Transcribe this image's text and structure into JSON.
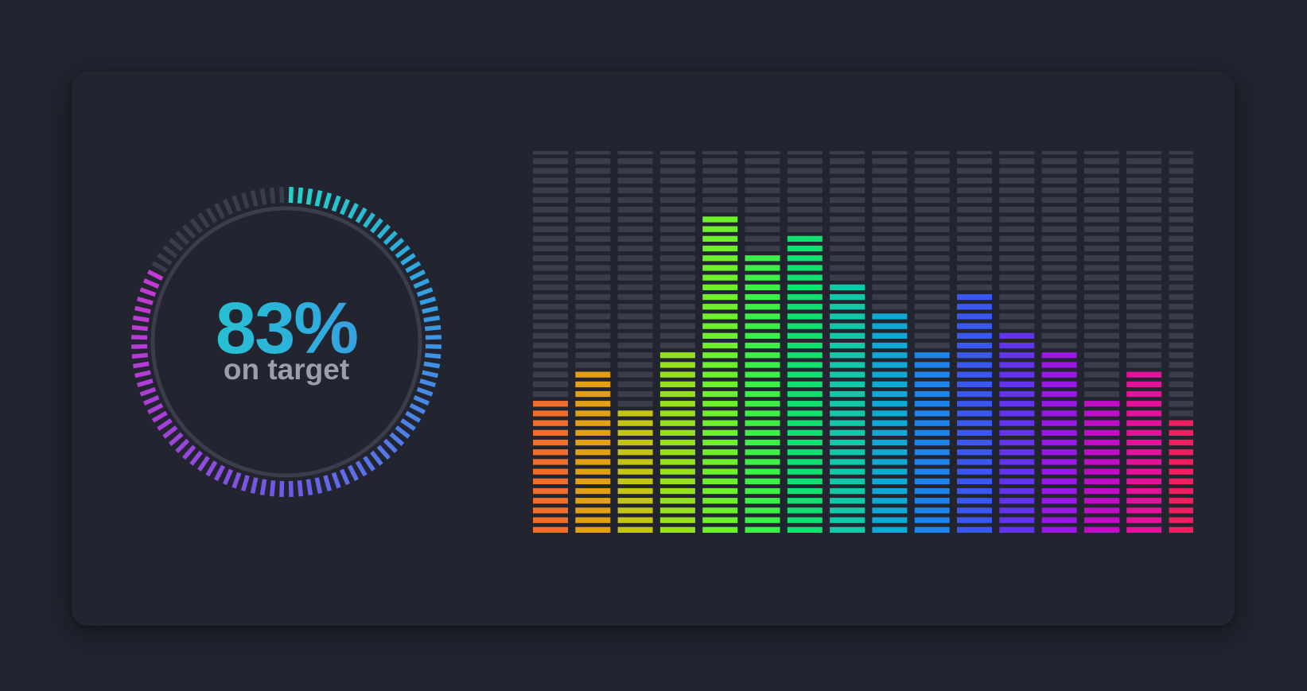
{
  "gauge": {
    "value": 0.83,
    "value_label": "83%",
    "caption": "on target",
    "track_color": "#3b3d4a",
    "gradient_colors": [
      "#1fd3c8",
      "#2fa6e0",
      "#4a84e8",
      "#6b5ce8",
      "#a63fd8",
      "#c43ad0"
    ]
  },
  "equalizer": {
    "segments_per_column": 40,
    "off_color": "#3b3d4a",
    "columns": [
      {
        "level": 14,
        "color": "#f06e2a"
      },
      {
        "level": 17,
        "color": "#e3a015"
      },
      {
        "level": 13,
        "color": "#c4c414"
      },
      {
        "level": 19,
        "color": "#97e01e"
      },
      {
        "level": 33,
        "color": "#6ef02d"
      },
      {
        "level": 29,
        "color": "#3df048"
      },
      {
        "level": 31,
        "color": "#10e070"
      },
      {
        "level": 26,
        "color": "#12c8a8"
      },
      {
        "level": 23,
        "color": "#10a8d4"
      },
      {
        "level": 19,
        "color": "#1c84ea"
      },
      {
        "level": 25,
        "color": "#3a58f0"
      },
      {
        "level": 21,
        "color": "#6234ee"
      },
      {
        "level": 19,
        "color": "#9a18e4"
      },
      {
        "level": 14,
        "color": "#c00ec8"
      },
      {
        "level": 17,
        "color": "#e2129a"
      },
      {
        "level": 12,
        "color": "#f02060"
      }
    ]
  }
}
